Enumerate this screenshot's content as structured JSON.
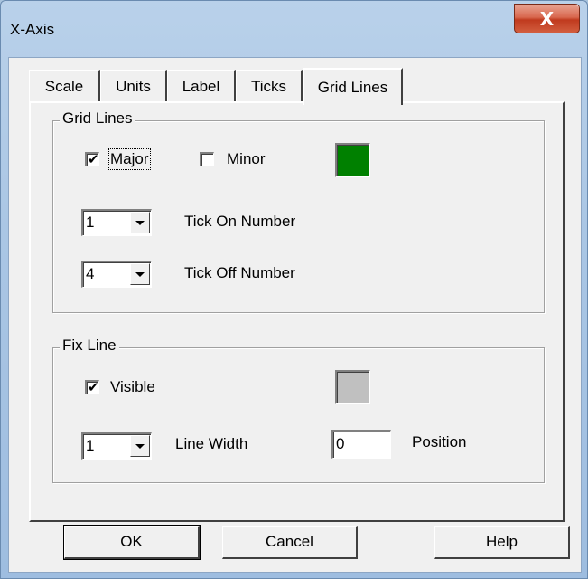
{
  "window": {
    "title": "X-Axis",
    "close_glyph": "X"
  },
  "tabs": [
    {
      "label": "Scale",
      "active": false
    },
    {
      "label": "Units",
      "active": false
    },
    {
      "label": "Label",
      "active": false
    },
    {
      "label": "Ticks",
      "active": false
    },
    {
      "label": "Grid Lines",
      "active": true
    }
  ],
  "grid_lines": {
    "group_label": "Grid Lines",
    "major": {
      "label": "Major",
      "checked": true
    },
    "minor": {
      "label": "Minor",
      "checked": false
    },
    "color": "#008000",
    "tick_on": {
      "value": "1",
      "label": "Tick On Number"
    },
    "tick_off": {
      "value": "4",
      "label": "Tick Off Number"
    }
  },
  "fix_line": {
    "group_label": "Fix Line",
    "visible": {
      "label": "Visible",
      "checked": true
    },
    "color": "#c0c0c0",
    "line_width": {
      "value": "1",
      "label": "Line Width"
    },
    "position": {
      "value": "0",
      "label": "Position"
    }
  },
  "buttons": {
    "ok": "OK",
    "cancel": "Cancel",
    "help": "Help"
  },
  "check_glyph": "✔"
}
